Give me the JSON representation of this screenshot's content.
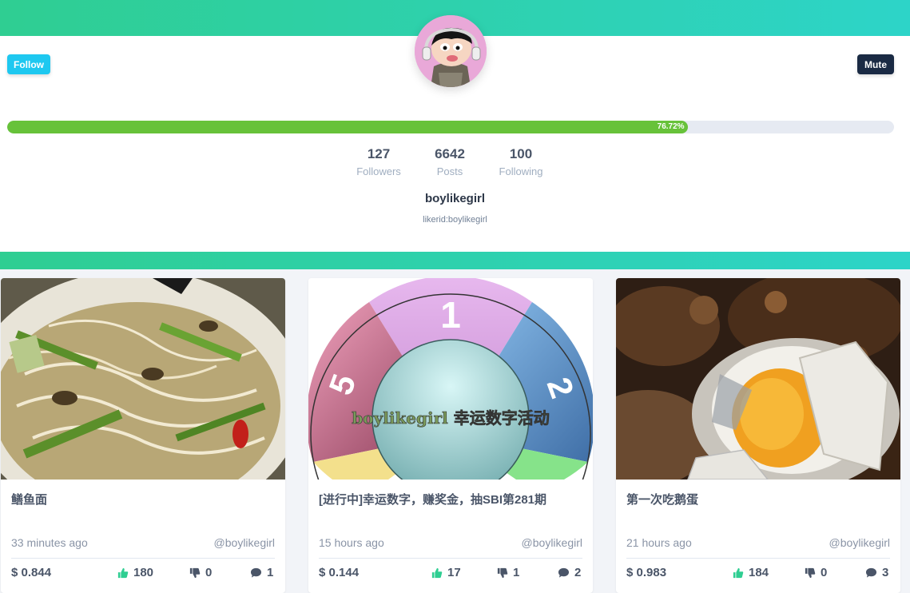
{
  "profile": {
    "follow_label": "Follow",
    "mute_label": "Mute",
    "progress": 0.7672,
    "progress_text": "76.72%",
    "stats": [
      {
        "value": "127",
        "label": "Followers"
      },
      {
        "value": "6642",
        "label": "Posts"
      },
      {
        "value": "100",
        "label": "Following"
      }
    ],
    "username": "boylikegirl",
    "likerid": "likerid:boylikegirl"
  },
  "colors": {
    "accent_gradient": [
      "#2fce92",
      "#2dd4c8"
    ],
    "follow_button": "#1ec8f0",
    "mute_button": "#1a2a44",
    "progress": "#67c23a",
    "like_icon": "#2fce92"
  },
  "wheel_text": "boylikegirl 幸运数字活动",
  "wheel_numbers": [
    "1",
    "2",
    "5"
  ],
  "posts": [
    {
      "title": "鳝鱼面",
      "time": "33 minutes ago",
      "author": "@boylikegirl",
      "price": "$ 0.844",
      "likes": "180",
      "dislikes": "0",
      "comments": "1"
    },
    {
      "title": "[进行中]幸运数字，赚奖金，抽SBI第281期",
      "time": "15 hours ago",
      "author": "@boylikegirl",
      "price": "$ 0.144",
      "likes": "17",
      "dislikes": "1",
      "comments": "2"
    },
    {
      "title": "第一次吃鹅蛋",
      "time": "21 hours ago",
      "author": "@boylikegirl",
      "price": "$ 0.983",
      "likes": "184",
      "dislikes": "0",
      "comments": "3"
    }
  ],
  "icons": {
    "like": "thumbs-up-icon",
    "dislike": "thumbs-down-icon",
    "comment": "comment-icon"
  }
}
